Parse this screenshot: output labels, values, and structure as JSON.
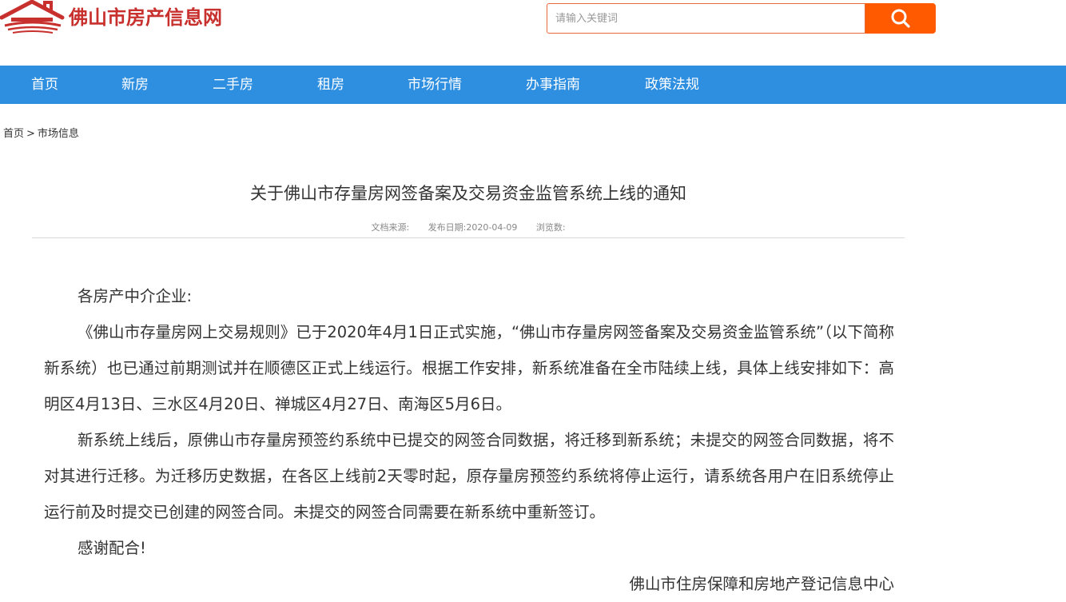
{
  "header": {
    "logo_text": "佛山市房产信息网",
    "logo_icon": "house-roof-logo-icon",
    "brand_color": "#c8302d"
  },
  "search": {
    "placeholder": "请输入关键词",
    "value": "",
    "button_icon": "search-icon",
    "button_color": "#ff5a00"
  },
  "nav": {
    "background": "#2e8fe0",
    "items": [
      {
        "label": "首页"
      },
      {
        "label": "新房"
      },
      {
        "label": "二手房"
      },
      {
        "label": "租房"
      },
      {
        "label": "市场行情"
      },
      {
        "label": "办事指南"
      },
      {
        "label": "政策法规"
      }
    ]
  },
  "breadcrumb": {
    "home": "首页",
    "separator": ">",
    "current": "市场信息"
  },
  "article": {
    "title": "关于佛山市存量房网签备案及交易资金监管系统上线的通知",
    "meta": {
      "source_label": "文档来源:",
      "date_label": "发布日期:",
      "date_value": "2020-04-09",
      "views_label": "浏览数:"
    },
    "salutation": "各房产中介企业:",
    "paragraphs": [
      "《佛山市存量房网上交易规则》已于2020年4月1日正式实施，“佛山市存量房网签备案及交易资金监管系统”（以下简称新系统）也已通过前期测试并在顺德区正式上线运行。根据工作安排，新系统准备在全市陆续上线，具体上线安排如下：高明区4月13日、三水区4月20日、禅城区4月27日、南海区5月6日。",
      "新系统上线后，原佛山市存量房预签约系统中已提交的网签合同数据，将迁移到新系统；未提交的网签合同数据，将不对其进行迁移。为迁移历史数据，在各区上线前2天零时起，原存量房预签约系统将停止运行，请系统各用户在旧系统停止运行前及时提交已创建的网签合同。未提交的网签合同需要在新系统中重新签订。"
    ],
    "closing": "感谢配合!",
    "signature": "佛山市住房保障和房地产登记信息中心"
  }
}
